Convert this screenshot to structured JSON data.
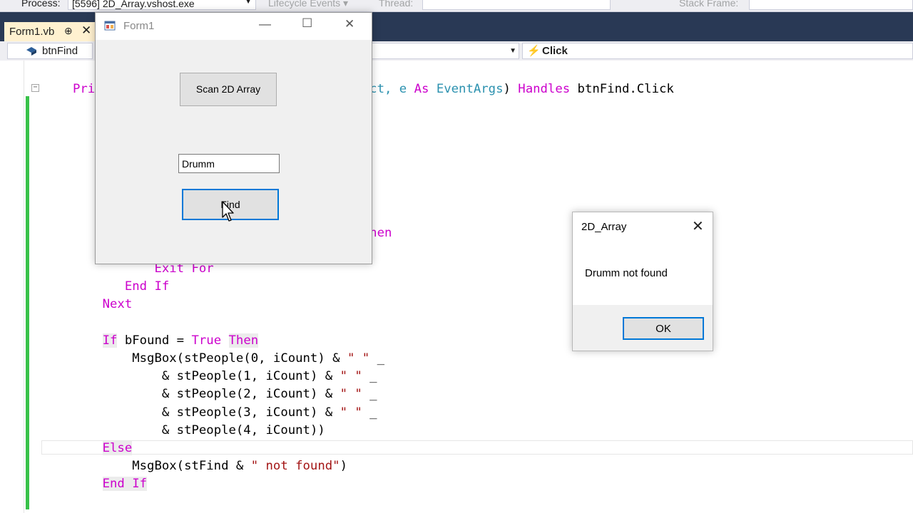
{
  "toolbar": {
    "process_label": "Process:",
    "process_value": "[5596] 2D_Array.vshost.exe",
    "lifecycle": "Lifecycle Events",
    "thread_label": "Thread:",
    "stackframe_label": "Stack Frame:"
  },
  "tab": {
    "name": "Form1.vb",
    "pin": "⊕",
    "close": "✕"
  },
  "nav": {
    "left": "btnFind",
    "right": "Click"
  },
  "code": {
    "line1": [
      "Pri",
      "ect, e ",
      "As",
      " ",
      "EventArgs",
      ") ",
      "Handles",
      " btnFind.Click"
    ],
    "line_then": "Then",
    "exit_for": "Exit For",
    "end_if_inner": "End If",
    "next": "Next",
    "if_found": [
      "If",
      " bFound = ",
      "True",
      " ",
      "Then"
    ],
    "msg1": [
      "MsgBox(stPeople(0, iCount) & ",
      "\" \"",
      " _"
    ],
    "msg2": [
      "& stPeople(1, iCount) & ",
      "\" \"",
      " _"
    ],
    "msg3": [
      "& stPeople(2, iCount) & ",
      "\" \"",
      " _"
    ],
    "msg4": [
      "& stPeople(3, iCount) & ",
      "\" \"",
      " _"
    ],
    "msg5": "& stPeople(4, iCount))",
    "else": "Else",
    "msg_notfound": [
      "MsgBox(stFind & ",
      "\" not found\"",
      ")"
    ],
    "end_if": "End If"
  },
  "form1": {
    "title": "Form1",
    "scan_button": "Scan 2D Array",
    "search_value": "Drumm",
    "find_button": "Find"
  },
  "msgbox": {
    "title": "2D_Array",
    "message": "Drumm not found",
    "ok_button": "OK"
  }
}
